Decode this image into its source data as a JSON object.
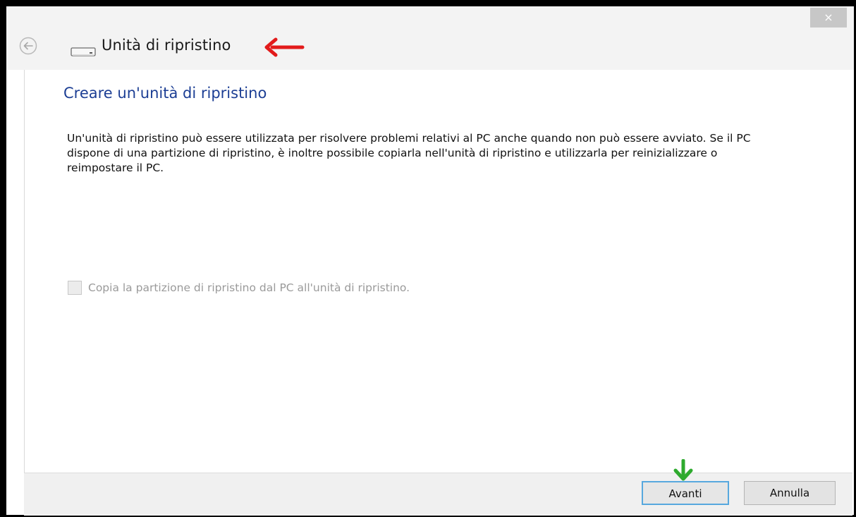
{
  "window": {
    "title": "Unità di ripristino",
    "close_label": "×",
    "back_icon": "back-arrow-icon",
    "drive_icon": "drive-icon"
  },
  "page": {
    "heading": "Creare un'unità di ripristino",
    "description": "Un'unità di ripristino può essere utilizzata per risolvere problemi relativi al PC anche quando non può essere avviato. Se il PC dispone di una partizione di ripristino, è inoltre possibile copiarla nell'unità di ripristino e utilizzarla per reinizializzare o reimpostare il PC.",
    "checkbox": {
      "label": "Copia la partizione di ripristino dal PC all'unità di ripristino.",
      "checked": false,
      "enabled": false
    }
  },
  "footer": {
    "next_label": "Avanti",
    "cancel_label": "Annulla"
  },
  "annotations": {
    "title_arrow_color": "#e21b1b",
    "next_arrow_color": "#2eaa2e"
  },
  "colors": {
    "heading": "#1c3e94",
    "button_focus_border": "#57a8de"
  }
}
